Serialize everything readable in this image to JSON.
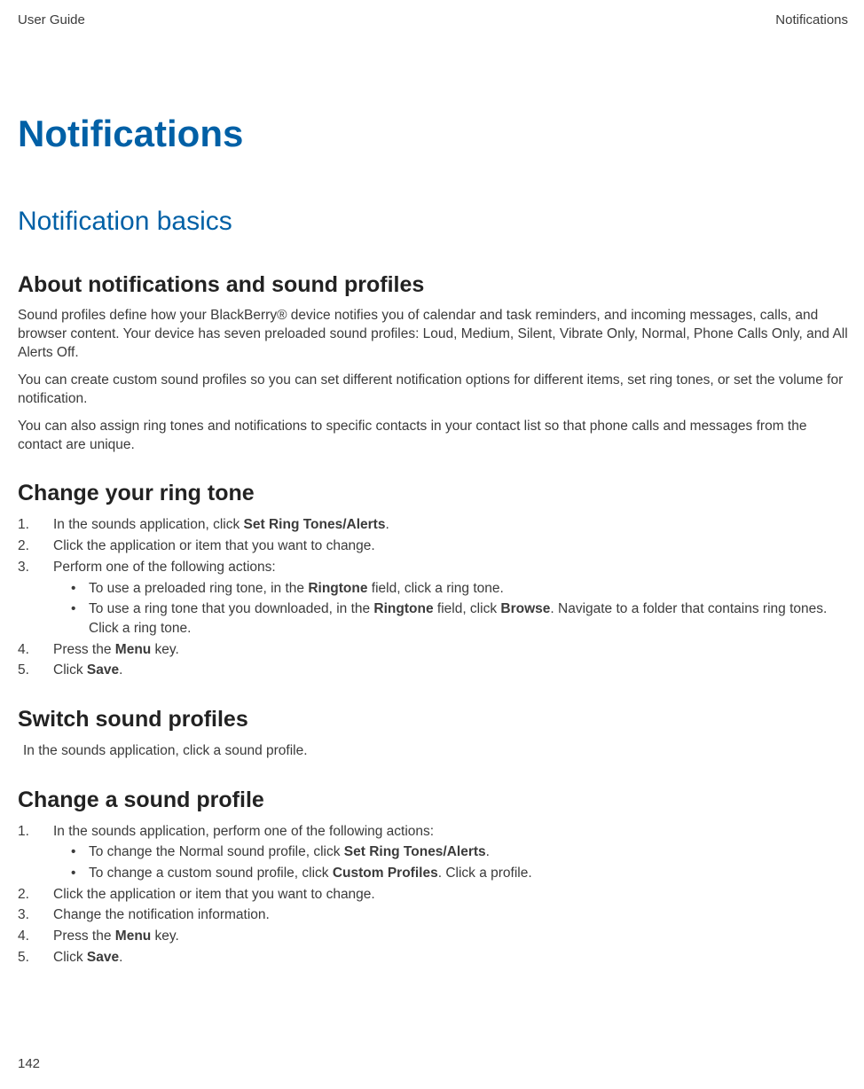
{
  "header": {
    "left": "User Guide",
    "right": "Notifications"
  },
  "titles": {
    "main": "Notifications",
    "section": "Notification basics",
    "about": "About notifications and sound profiles",
    "changeRing": "Change your ring tone",
    "switchProfiles": "Switch sound profiles",
    "changeProfile": "Change a sound profile"
  },
  "about": {
    "p1": "Sound profiles define how your BlackBerry® device notifies you of calendar and task reminders, and incoming messages, calls, and browser content. Your device has seven preloaded sound profiles: Loud, Medium, Silent, Vibrate Only, Normal, Phone Calls Only, and All Alerts Off.",
    "p2": "You can create custom sound profiles so you can set different notification options for different items, set ring tones, or set the volume for notification.",
    "p3": "You can also assign ring tones and notifications to specific contacts in your contact list so that phone calls and messages from the contact are unique."
  },
  "changeRing": {
    "step1_pre": "In the sounds application, click ",
    "step1_bold": "Set Ring Tones/Alerts",
    "step1_post": ".",
    "step2": "Click the application or item that you want to change.",
    "step3": "Perform one of the following actions:",
    "step3_b1_pre": "To use a preloaded ring tone, in the ",
    "step3_b1_bold": "Ringtone",
    "step3_b1_post": " field, click a ring tone.",
    "step3_b2_pre": "To use a ring tone that you downloaded, in the ",
    "step3_b2_bold1": "Ringtone",
    "step3_b2_mid": " field, click ",
    "step3_b2_bold2": "Browse",
    "step3_b2_post": ". Navigate to a folder that contains ring tones. Click a ring tone.",
    "step4_pre": "Press the ",
    "step4_bold": "Menu",
    "step4_post": " key.",
    "step5_pre": "Click ",
    "step5_bold": "Save",
    "step5_post": "."
  },
  "switchProfiles": {
    "p1": "In the sounds application, click a sound profile."
  },
  "changeProfile": {
    "step1": "In the sounds application, perform one of the following actions:",
    "step1_b1_pre": "To change the Normal sound profile, click ",
    "step1_b1_bold": "Set Ring Tones/Alerts",
    "step1_b1_post": ".",
    "step1_b2_pre": "To change a custom sound profile, click ",
    "step1_b2_bold": "Custom Profiles",
    "step1_b2_post": ". Click a profile.",
    "step2": "Click the application or item that you want to change.",
    "step3": "Change the notification information.",
    "step4_pre": "Press the ",
    "step4_bold": "Menu",
    "step4_post": " key.",
    "step5_pre": "Click ",
    "step5_bold": "Save",
    "step5_post": "."
  },
  "pageNumber": "142"
}
